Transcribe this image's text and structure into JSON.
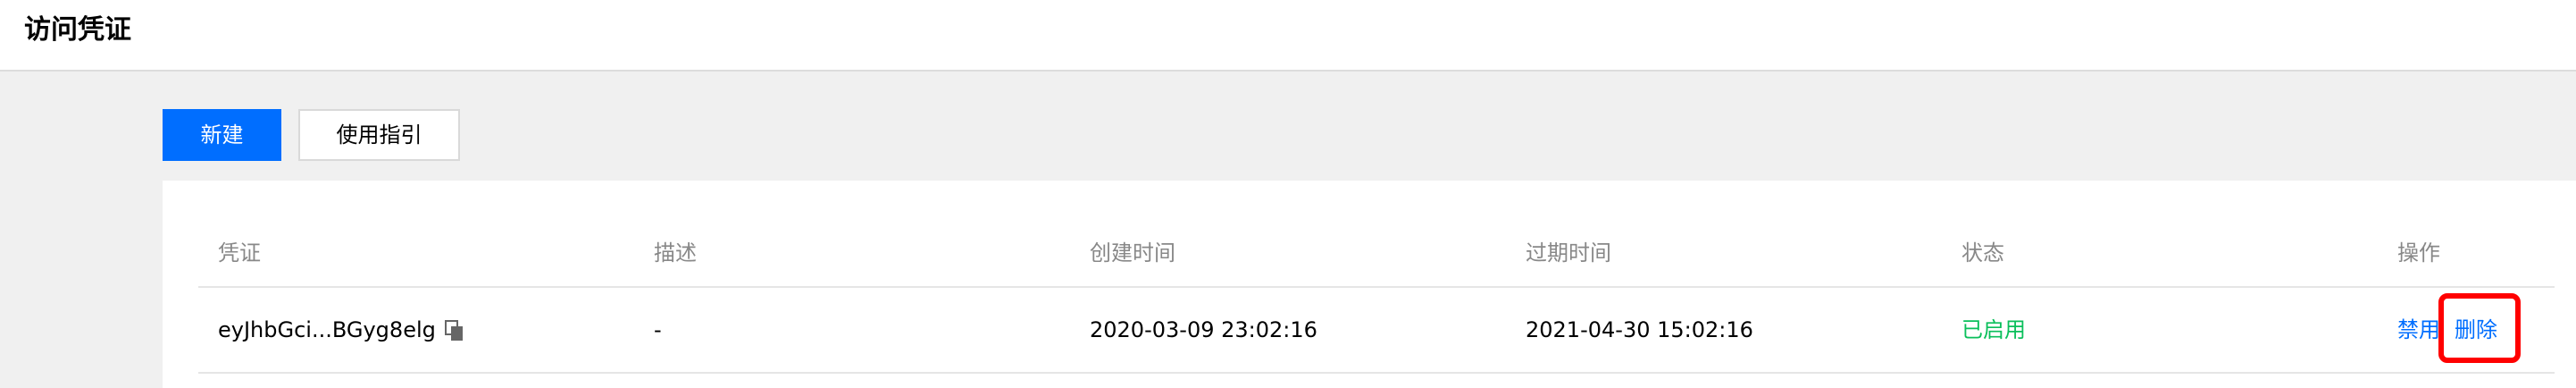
{
  "header": {
    "title": "访问凭证"
  },
  "toolbar": {
    "new_label": "新建",
    "guide_label": "使用指引"
  },
  "table": {
    "columns": [
      "凭证",
      "描述",
      "创建时间",
      "过期时间",
      "状态",
      "操作"
    ],
    "rows": [
      {
        "credential": "eyJhbGci...BGyg8elg",
        "description": "-",
        "created": "2020-03-09 23:02:16",
        "expires": "2021-04-30 15:02:16",
        "status": "已启用",
        "actions": {
          "disable": "禁用",
          "delete": "删除"
        }
      }
    ]
  },
  "colors": {
    "primary": "#006eff",
    "status_enabled": "#0abf5b",
    "highlight": "#ff0000"
  },
  "icons": {
    "copy": "copy-icon"
  }
}
